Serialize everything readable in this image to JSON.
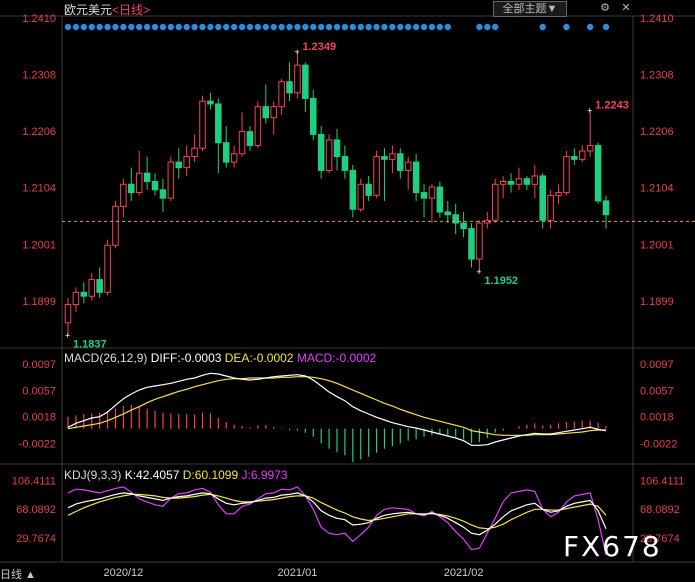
{
  "header": {
    "symbol": "欧元美元",
    "period": "<日线>",
    "theme_button": "全部主题▼",
    "period_indicator": "日线"
  },
  "macd": {
    "title": "MACD(26,12,9)",
    "diff_label": "DIFF:-0.0003",
    "dea_label": "DEA:-0.0002",
    "macd_label": "MACD:-0.0002"
  },
  "kdj": {
    "title": "KDJ(9,3,3)",
    "k_label": "K:42.4057",
    "d_label": "D:60.1099",
    "j_label": "J:6.9973"
  },
  "watermark": "FX678",
  "colors": {
    "up": "#f0445a",
    "down": "#1fcf7f",
    "diff": "#ffffff",
    "dea": "#f5e34a",
    "j": "#e040fb",
    "dot": "#2b8de0",
    "axis": "#e04050"
  },
  "chart_data": {
    "type": "candlestick",
    "price_ticks": [
      "1.2410",
      "1.2308",
      "1.2206",
      "1.2104",
      "1.2001",
      "1.1899"
    ],
    "macd_ticks": [
      "0.0097",
      "0.0057",
      "0.0018",
      "-0.0022"
    ],
    "kdj_ticks": [
      "106.4111",
      "68.0892",
      "29.7674"
    ],
    "x_labels": [
      {
        "label": "2020/12",
        "index": 7
      },
      {
        "label": "2021/01",
        "index": 29
      },
      {
        "label": "2021/02",
        "index": 50
      }
    ],
    "annotations": [
      {
        "label": "1.2349",
        "index": 29,
        "type": "high"
      },
      {
        "label": "1.2243",
        "index": 66,
        "type": "high"
      },
      {
        "label": "1.1952",
        "index": 52,
        "type": "low"
      },
      {
        "label": "1.1837",
        "index": 0,
        "type": "low"
      }
    ],
    "last_price": 1.2043,
    "ohlc": [
      [
        1.186,
        1.1905,
        1.1837,
        1.1893
      ],
      [
        1.1893,
        1.1924,
        1.188,
        1.1915
      ],
      [
        1.1915,
        1.1933,
        1.1895,
        1.1908
      ],
      [
        1.1908,
        1.195,
        1.19,
        1.1938
      ],
      [
        1.1938,
        1.196,
        1.1905,
        1.1915
      ],
      [
        1.1915,
        1.201,
        1.191,
        1.2
      ],
      [
        1.2,
        1.208,
        1.1995,
        1.207
      ],
      [
        1.207,
        1.212,
        1.205,
        1.211
      ],
      [
        1.211,
        1.214,
        1.208,
        1.2095
      ],
      [
        1.2095,
        1.217,
        1.209,
        1.213
      ],
      [
        1.213,
        1.216,
        1.21,
        1.2115
      ],
      [
        1.2115,
        1.213,
        1.209,
        1.21
      ],
      [
        1.21,
        1.212,
        1.206,
        1.2085
      ],
      [
        1.2085,
        1.216,
        1.208,
        1.215
      ],
      [
        1.215,
        1.2175,
        1.212,
        1.214
      ],
      [
        1.214,
        1.218,
        1.2125,
        1.216
      ],
      [
        1.216,
        1.22,
        1.215,
        1.2175
      ],
      [
        1.2175,
        1.227,
        1.217,
        1.226
      ],
      [
        1.226,
        1.2275,
        1.2245,
        1.2255
      ],
      [
        1.2255,
        1.2265,
        1.213,
        1.2185
      ],
      [
        1.2185,
        1.2215,
        1.214,
        1.215
      ],
      [
        1.215,
        1.218,
        1.214,
        1.2165
      ],
      [
        1.2165,
        1.224,
        1.216,
        1.2205
      ],
      [
        1.2205,
        1.2215,
        1.217,
        1.218
      ],
      [
        1.218,
        1.226,
        1.2175,
        1.225
      ],
      [
        1.225,
        1.229,
        1.222,
        1.223
      ],
      [
        1.223,
        1.226,
        1.22,
        1.225
      ],
      [
        1.225,
        1.23,
        1.2235,
        1.2295
      ],
      [
        1.2295,
        1.233,
        1.226,
        1.2275
      ],
      [
        1.2275,
        1.2349,
        1.2265,
        1.2325
      ],
      [
        1.2325,
        1.233,
        1.224,
        1.2265
      ],
      [
        1.2265,
        1.228,
        1.219,
        1.22
      ],
      [
        1.22,
        1.2215,
        1.212,
        1.2135
      ],
      [
        1.2135,
        1.22,
        1.213,
        1.219
      ],
      [
        1.219,
        1.221,
        1.2135,
        1.216
      ],
      [
        1.216,
        1.218,
        1.212,
        1.2135
      ],
      [
        1.2135,
        1.2145,
        1.205,
        1.2065
      ],
      [
        1.2065,
        1.212,
        1.206,
        1.211
      ],
      [
        1.211,
        1.2125,
        1.208,
        1.209
      ],
      [
        1.209,
        1.217,
        1.2085,
        1.216
      ],
      [
        1.216,
        1.2175,
        1.208,
        1.2155
      ],
      [
        1.2155,
        1.218,
        1.213,
        1.2165
      ],
      [
        1.2165,
        1.2175,
        1.212,
        1.2135
      ],
      [
        1.2135,
        1.216,
        1.21,
        1.215
      ],
      [
        1.215,
        1.2165,
        1.208,
        1.2095
      ],
      [
        1.2095,
        1.211,
        1.205,
        1.2085
      ],
      [
        1.2085,
        1.211,
        1.204,
        1.2105
      ],
      [
        1.2105,
        1.2115,
        1.205,
        1.206
      ],
      [
        1.206,
        1.208,
        1.204,
        1.2055
      ],
      [
        1.2055,
        1.2075,
        1.202,
        1.204
      ],
      [
        1.204,
        1.206,
        1.2015,
        1.203
      ],
      [
        1.203,
        1.204,
        1.196,
        1.1975
      ],
      [
        1.1975,
        1.2045,
        1.1952,
        1.204
      ],
      [
        1.204,
        1.206,
        1.203,
        1.2045
      ],
      [
        1.2045,
        1.212,
        1.204,
        1.211
      ],
      [
        1.211,
        1.2125,
        1.2085,
        1.2115
      ],
      [
        1.2115,
        1.213,
        1.2095,
        1.211
      ],
      [
        1.211,
        1.214,
        1.21,
        1.212
      ],
      [
        1.212,
        1.2125,
        1.21,
        1.211
      ],
      [
        1.211,
        1.2145,
        1.2085,
        1.2125
      ],
      [
        1.2125,
        1.213,
        1.203,
        1.2045
      ],
      [
        1.2045,
        1.21,
        1.203,
        1.209
      ],
      [
        1.209,
        1.211,
        1.2075,
        1.2095
      ],
      [
        1.2095,
        1.217,
        1.209,
        1.216
      ],
      [
        1.216,
        1.2175,
        1.2145,
        1.2155
      ],
      [
        1.2155,
        1.218,
        1.215,
        1.217
      ],
      [
        1.217,
        1.2243,
        1.216,
        1.218
      ],
      [
        1.218,
        1.2185,
        1.2075,
        1.208
      ],
      [
        1.208,
        1.209,
        1.203,
        1.2055
      ]
    ],
    "macd_hist": [
      0.0018,
      0.002,
      0.0022,
      0.0023,
      0.0024,
      0.0026,
      0.003,
      0.0034,
      0.0036,
      0.0033,
      0.003,
      0.0027,
      0.0024,
      0.0023,
      0.0022,
      0.0022,
      0.0021,
      0.0024,
      0.0023,
      0.0016,
      0.001,
      0.0006,
      0.0004,
      0.0002,
      0.0005,
      0.0006,
      0.0003,
      0.0001,
      -0.0002,
      -0.0003,
      -0.0006,
      -0.0012,
      -0.0022,
      -0.003,
      -0.0035,
      -0.004,
      -0.005,
      -0.0046,
      -0.0042,
      -0.0036,
      -0.003,
      -0.0026,
      -0.0022,
      -0.0018,
      -0.0016,
      -0.0012,
      -0.001,
      -0.0008,
      -0.001,
      -0.0012,
      -0.0016,
      -0.0022,
      -0.002,
      -0.0014,
      -0.0006,
      -0.0003,
      0.0,
      0.0004,
      0.0006,
      0.0008,
      0.0005,
      0.0006,
      0.0008,
      0.001,
      0.0011,
      0.0012,
      0.0012,
      0.0009,
      0.0004
    ],
    "macd_diff": [
      0.0002,
      0.0008,
      0.0012,
      0.0016,
      0.0018,
      0.0025,
      0.0035,
      0.0045,
      0.0052,
      0.0058,
      0.0062,
      0.0064,
      0.0066,
      0.0068,
      0.0071,
      0.0074,
      0.0076,
      0.008,
      0.0083,
      0.0082,
      0.0079,
      0.0076,
      0.0074,
      0.0073,
      0.0074,
      0.0076,
      0.0078,
      0.0079,
      0.008,
      0.0081,
      0.0079,
      0.0073,
      0.0064,
      0.0055,
      0.0048,
      0.0042,
      0.0033,
      0.0027,
      0.0022,
      0.0017,
      0.0013,
      0.0009,
      0.0006,
      0.0003,
      0.0001,
      -0.0002,
      -0.0005,
      -0.0008,
      -0.0011,
      -0.0014,
      -0.0018,
      -0.0025,
      -0.0025,
      -0.0024,
      -0.002,
      -0.0017,
      -0.0014,
      -0.0011,
      -0.0009,
      -0.0007,
      -0.0008,
      -0.0008,
      -0.0006,
      -0.0004,
      -0.0002,
      0.0,
      0.0002,
      -0.0001,
      -0.0003
    ],
    "macd_dea": [
      0.0,
      0.0002,
      0.0004,
      0.0006,
      0.0008,
      0.0012,
      0.0017,
      0.0022,
      0.0028,
      0.0033,
      0.0039,
      0.0044,
      0.0048,
      0.0052,
      0.0056,
      0.0059,
      0.0063,
      0.0066,
      0.0069,
      0.0072,
      0.0074,
      0.0075,
      0.0075,
      0.0076,
      0.0076,
      0.0076,
      0.0076,
      0.0077,
      0.0077,
      0.0078,
      0.0078,
      0.0077,
      0.0075,
      0.0072,
      0.0068,
      0.0063,
      0.0058,
      0.0053,
      0.0048,
      0.0043,
      0.0038,
      0.0034,
      0.0029,
      0.0025,
      0.0021,
      0.0017,
      0.0014,
      0.0011,
      0.0008,
      0.0005,
      0.0002,
      -0.0003,
      -0.0005,
      -0.0007,
      -0.0009,
      -0.001,
      -0.001,
      -0.001,
      -0.001,
      -0.0009,
      -0.0009,
      -0.0009,
      -0.0008,
      -0.0007,
      -0.0006,
      -0.0005,
      -0.0003,
      -0.0002,
      -0.0002
    ],
    "kdj_k": [
      70,
      75,
      78,
      80,
      82,
      85,
      88,
      90,
      89,
      86,
      84,
      82,
      80,
      83,
      85,
      86,
      88,
      90,
      89,
      82,
      76,
      74,
      76,
      77,
      80,
      83,
      84,
      87,
      88,
      90,
      86,
      78,
      66,
      60,
      56,
      54,
      47,
      48,
      50,
      56,
      60,
      62,
      63,
      64,
      62,
      61,
      63,
      60,
      56,
      50,
      44,
      36,
      34,
      40,
      48,
      58,
      66,
      70,
      74,
      76,
      68,
      64,
      66,
      72,
      76,
      78,
      80,
      66,
      42
    ],
    "kdj_d": [
      60,
      65,
      70,
      74,
      78,
      81,
      84,
      86,
      88,
      88,
      87,
      86,
      84,
      83,
      83,
      84,
      85,
      87,
      88,
      86,
      83,
      80,
      78,
      78,
      79,
      80,
      81,
      83,
      85,
      86,
      86,
      83,
      77,
      72,
      67,
      63,
      58,
      55,
      53,
      54,
      56,
      58,
      60,
      62,
      62,
      62,
      62,
      61,
      59,
      56,
      52,
      47,
      43,
      42,
      44,
      48,
      54,
      59,
      64,
      68,
      68,
      67,
      67,
      69,
      71,
      73,
      75,
      72,
      60
    ],
    "kdj_j": [
      90,
      95,
      94,
      92,
      90,
      93,
      96,
      98,
      91,
      82,
      78,
      74,
      72,
      83,
      89,
      90,
      94,
      96,
      91,
      74,
      62,
      62,
      72,
      75,
      82,
      89,
      90,
      95,
      94,
      98,
      86,
      68,
      44,
      36,
      34,
      36,
      25,
      34,
      44,
      60,
      68,
      70,
      69,
      68,
      62,
      59,
      65,
      58,
      50,
      38,
      28,
      14,
      16,
      36,
      56,
      78,
      90,
      92,
      94,
      92,
      68,
      58,
      64,
      78,
      86,
      88,
      90,
      54,
      7
    ]
  }
}
